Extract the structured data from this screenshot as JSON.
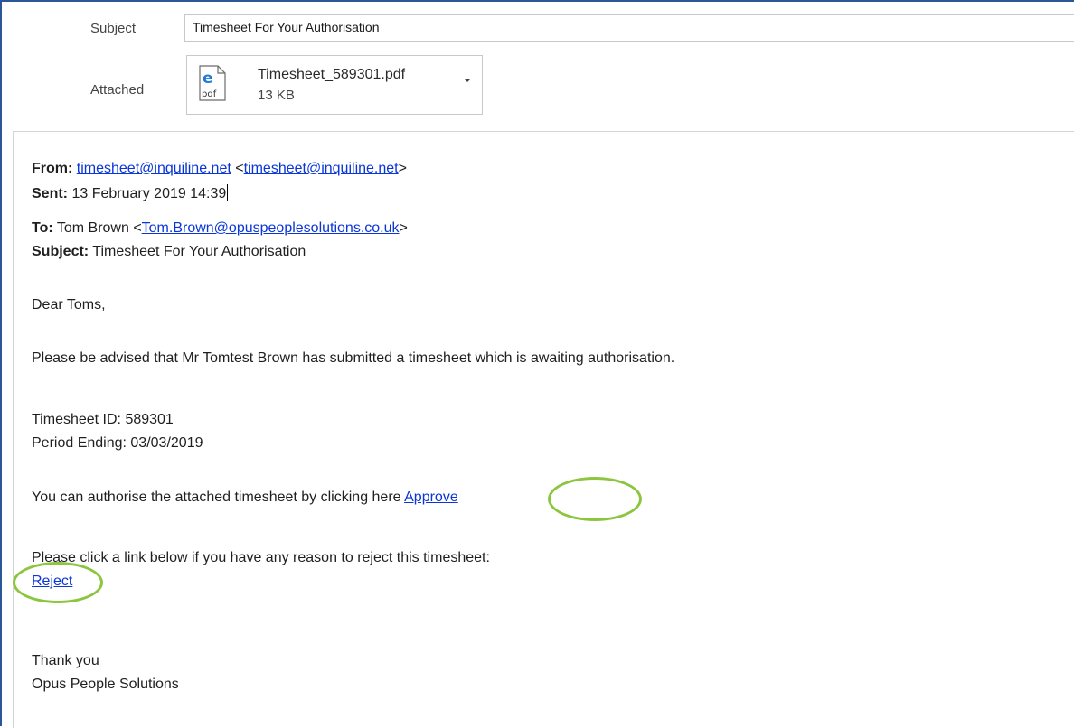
{
  "header": {
    "subject_label": "Subject",
    "subject_value": "Timesheet For Your Authorisation",
    "attached_label": "Attached",
    "attachment": {
      "file_name": "Timesheet_589301.pdf",
      "file_size": "13 KB",
      "icon_type": "pdf-file-icon",
      "icon_letter": "e",
      "icon_ext": "pdf"
    }
  },
  "email": {
    "from_label": "From:",
    "from_address": "timesheet@inquiline.net",
    "from_open": "<",
    "from_address2": "timesheet@inquiline.net",
    "from_close": ">",
    "sent_label": "Sent:",
    "sent_value": "13 February 2019 14:39",
    "to_label": "To:",
    "to_name": "Tom Brown <",
    "to_address": "Tom.Brown@opuspeoplesolutions.co.uk",
    "to_close": ">",
    "subject_label": "Subject:",
    "subject_value": "Timesheet For Your Authorisation",
    "greeting": "Dear Toms,",
    "paragraph1": "Please be advised that Mr Tomtest Brown has submitted a timesheet which is awaiting authorisation.",
    "timesheet_id_line": "Timesheet ID: 589301",
    "period_ending_line": "Period Ending: 03/03/2019",
    "authorise_text": "You can authorise the attached timesheet by clicking here",
    "approve_link": "Approve",
    "reject_prompt": "Please click a link below if you have any reason to reject this timesheet:",
    "reject_link": "Reject",
    "thanks": "Thank you",
    "signature": "Opus People Solutions"
  },
  "colors": {
    "link": "#0a36d8",
    "highlight_ellipse": "#8cc63f",
    "frame_border": "#2b579a"
  }
}
